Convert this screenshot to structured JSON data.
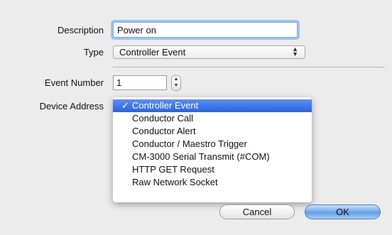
{
  "form": {
    "description_label": "Description",
    "description_value": "Power on",
    "type_label": "Type",
    "type_value": "Controller Event",
    "event_number_label": "Event Number",
    "event_number_value": "1",
    "device_address_label": "Device Address"
  },
  "menu": {
    "check_mark": "✓",
    "items": [
      {
        "label": "Controller Event",
        "selected": true
      },
      {
        "label": "Conductor Call",
        "selected": false
      },
      {
        "label": "Conductor Alert",
        "selected": false
      },
      {
        "label": "Conductor / Maestro Trigger",
        "selected": false
      },
      {
        "label": "CM-3000 Serial Transmit (#COM)",
        "selected": false
      },
      {
        "label": "HTTP GET Request",
        "selected": false
      },
      {
        "label": "Raw Network Socket",
        "selected": false
      }
    ]
  },
  "buttons": {
    "cancel_label": "Cancel",
    "ok_label": "OK"
  },
  "colors": {
    "accent": "#2b63dd",
    "focus_ring": "#9fc3ee",
    "background": "#ececec"
  }
}
